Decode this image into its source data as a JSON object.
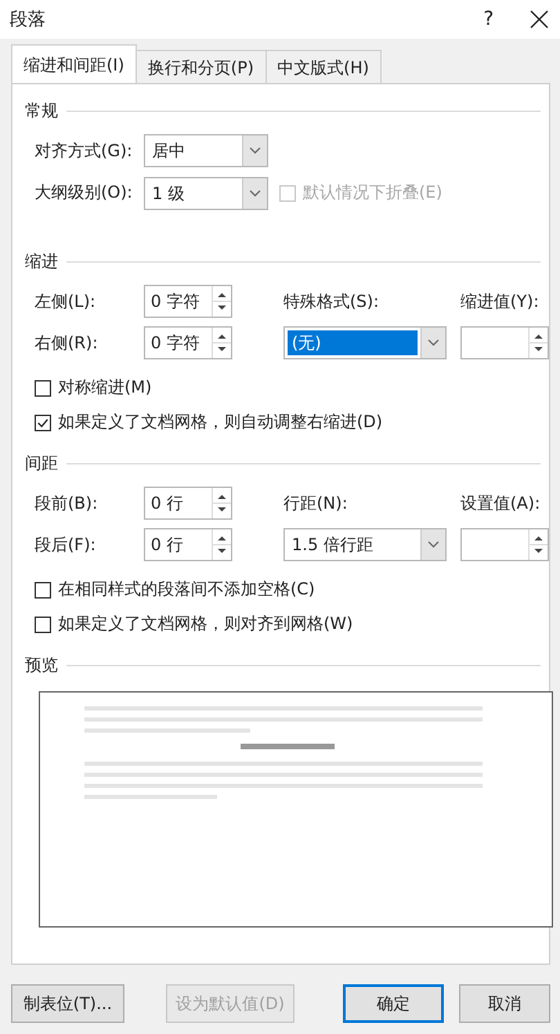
{
  "window": {
    "title": "段落",
    "help": "?"
  },
  "tabs": [
    {
      "label": "缩进和间距(I)",
      "selected": true
    },
    {
      "label": "换行和分页(P)",
      "selected": false
    },
    {
      "label": "中文版式(H)",
      "selected": false
    }
  ],
  "general": {
    "heading": "常规",
    "alignment": {
      "label": "对齐方式(G):",
      "value": "居中"
    },
    "outline_level": {
      "label": "大纲级别(O):",
      "value": "1 级"
    },
    "collapse": {
      "label": "默认情况下折叠(E)",
      "checked": false,
      "disabled": true
    }
  },
  "indentation": {
    "heading": "缩进",
    "left": {
      "label": "左侧(L):",
      "value": "0 字符"
    },
    "right": {
      "label": "右侧(R):",
      "value": "0 字符"
    },
    "special": {
      "label": "特殊格式(S):",
      "value": "(无)",
      "highlighted": true
    },
    "by": {
      "label": "缩进值(Y):"
    },
    "checkboxes": [
      {
        "label": "对称缩进(M)",
        "checked": false,
        "disabled": false
      },
      {
        "label": "如果定义了文档网格，则自动调整右缩进(D)",
        "checked": true,
        "disabled": false
      }
    ]
  },
  "spacing": {
    "heading": "间距",
    "before": {
      "label": "段前(B):",
      "value": "0 行"
    },
    "after": {
      "label": "段后(F):",
      "value": "0 行"
    },
    "line_spacing": {
      "label": "行距(N):",
      "value": "1.5 倍行距",
      "highlighted": false
    },
    "at": {
      "label": "设置值(A):"
    },
    "checkboxes": [
      {
        "label": "在相同样式的段落间不添加空格(C)",
        "checked": false,
        "disabled": false
      },
      {
        "label": "如果定义了文档网格，则对齐到网格(W)",
        "checked": false,
        "disabled": false
      }
    ]
  },
  "preview": {
    "heading": "预览"
  },
  "buttons": [
    {
      "label": "制表位(T)...",
      "disabled": false,
      "default": false
    },
    {
      "label": "设为默认值(D)",
      "disabled": true,
      "default": false
    },
    {
      "label": "确定",
      "disabled": false,
      "default": true
    },
    {
      "label": "取消",
      "disabled": false,
      "default": false
    }
  ]
}
